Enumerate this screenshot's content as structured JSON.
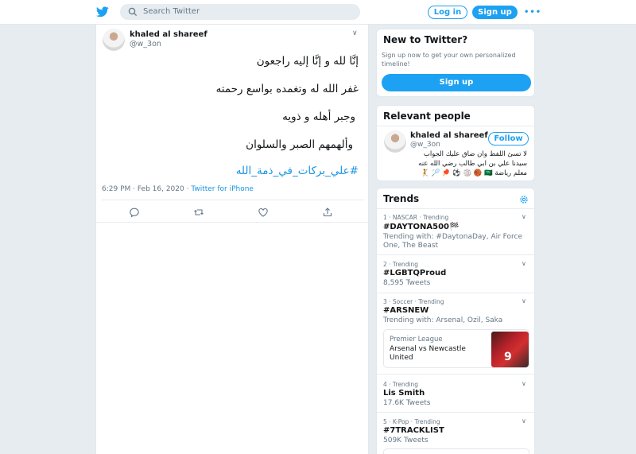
{
  "header": {
    "search_placeholder": "Search Twitter",
    "login_label": "Log in",
    "signup_label": "Sign up",
    "more_label": "•••"
  },
  "tweet": {
    "name": "khaled al shareef",
    "handle": "@w_3on",
    "lines": [
      "إنَّا لله و إنَّا إليه راجعون",
      "غفر الله له وتغمده بواسع رحمته",
      "وجبر أهله و ذويه",
      "وألهمهم الصبر  والسلوان"
    ],
    "hashtag": "#علي_بركات_في_ذمة_الله",
    "timestamp": "6:29 PM · Feb 16, 2020",
    "separator": " · ",
    "source": "Twitter for iPhone"
  },
  "new_to_twitter": {
    "title": "New to Twitter?",
    "description": "Sign up now to get your own personalized timeline!",
    "button": "Sign up"
  },
  "relevant_people": {
    "title": "Relevant people",
    "name": "khaled al shareef",
    "handle": "@w_3on",
    "follow_label": "Follow",
    "bio_lines": [
      "لا تسئ اللفظ وان ضاق عليك الجواب",
      "سيدنا علي بن ابي طالب رضي الله عنه",
      "معلم رياضة 🇸🇦 🏀 🏐 ⚽ 🏓 🏸 🤾"
    ]
  },
  "trends": {
    "title": "Trends",
    "items": [
      {
        "meta": "1 · NASCAR · Trending",
        "name": "#DAYTONA500🏁",
        "sub": "Trending with: #DaytonaDay, Air Force One, The Beast"
      },
      {
        "meta": "2 · Trending",
        "name": "#LGBTQProud",
        "sub": "8,595 Tweets"
      },
      {
        "meta": "3 · Soccer · Trending",
        "name": "#ARSNEW",
        "sub": "Trending with: Arsenal, Ozil, Saka"
      },
      {
        "meta": "4 · Trending",
        "name": "Lis Smith",
        "sub": "17.6K Tweets"
      },
      {
        "meta": "5 · K-Pop · Trending",
        "name": "#7TRACKLIST",
        "sub": "509K Tweets"
      }
    ],
    "news": {
      "source": "Premier League",
      "headline": "Arsenal vs Newcastle United",
      "jersey_number": "9"
    }
  },
  "colors": {
    "accent": "#1da1f2",
    "link": "#1b95e0",
    "secondary_text": "#657786",
    "background": "#e6ecf0"
  },
  "icons": [
    "twitter-bird-icon",
    "search-icon",
    "chevron-down-icon",
    "reply-icon",
    "retweet-icon",
    "like-icon",
    "share-icon",
    "gear-icon"
  ]
}
